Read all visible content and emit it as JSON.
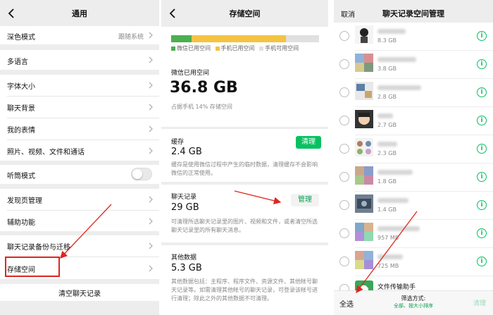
{
  "settings_panel": {
    "title": "通用",
    "items": [
      {
        "label": "深色模式",
        "value": "跟随系统"
      },
      {
        "label": "多语言",
        "value": ""
      },
      {
        "label": "字体大小",
        "value": ""
      },
      {
        "label": "聊天背景",
        "value": ""
      },
      {
        "label": "我的表情",
        "value": ""
      },
      {
        "label": "照片、视频、文件和通话",
        "value": ""
      },
      {
        "label": "听筒模式",
        "value": ""
      },
      {
        "label": "发现页管理",
        "value": ""
      },
      {
        "label": "辅助功能",
        "value": ""
      },
      {
        "label": "聊天记录备份与迁移",
        "value": ""
      },
      {
        "label": "存储空间",
        "value": ""
      }
    ],
    "earpiece_mode_on": false,
    "clear_history_label": "清空聊天记录"
  },
  "storage_panel": {
    "title": "存储空间",
    "bar": {
      "wechat_fraction": 0.14,
      "phone_used_fraction": 0.64
    },
    "legend": {
      "wechat": "微信已用空间",
      "phone_used": "手机已用空间",
      "phone_free": "手机可用空间"
    },
    "colors": {
      "wechat": "#4caf50",
      "phone_used": "#f5c342",
      "phone_free": "#e0e0e0"
    },
    "wechat_used_label": "微信已用空间",
    "wechat_used_size": "36.8 GB",
    "wechat_used_percent_text": "占据手机 14% 存储空间",
    "cache": {
      "label": "缓存",
      "size": "2.4 GB",
      "desc": "缓存是使用微信过程中产生的临时数据，清理缓存不会影响微信的正常使用。",
      "button": "清理"
    },
    "chat": {
      "label": "聊天记录",
      "size": "29 GB",
      "desc": "可清理所选聊天记录里的图片、视频和文件，或者清空所选聊天记录里的所有聊天消息。",
      "button": "管理"
    },
    "other": {
      "label": "其他数据",
      "size": "5.3 GB",
      "desc": "其他数据包括：主程序、程序文件、资源文件、其他帐号聊天记录等。如需清理其他帐号的聊天记录，可登录该帐号进行清理；除此之外的其他数据不可清理。"
    }
  },
  "chat_manage_panel": {
    "title": "聊天记录空间管理",
    "cancel": "取消",
    "rows": [
      {
        "size": "8.3 GB"
      },
      {
        "size": "3.8 GB"
      },
      {
        "size": "2.8 GB"
      },
      {
        "size": "2.7 GB"
      },
      {
        "size": "2.3 GB"
      },
      {
        "size": "1.8 GB"
      },
      {
        "size": "1.4 GB"
      },
      {
        "size": "957 MB"
      },
      {
        "size": "725 MB"
      },
      {
        "name": "文件传输助手"
      }
    ],
    "select_all": "全选",
    "filter_title": "筛选方式:",
    "filter_value": "全部、按大小排序",
    "clear": "清理"
  }
}
